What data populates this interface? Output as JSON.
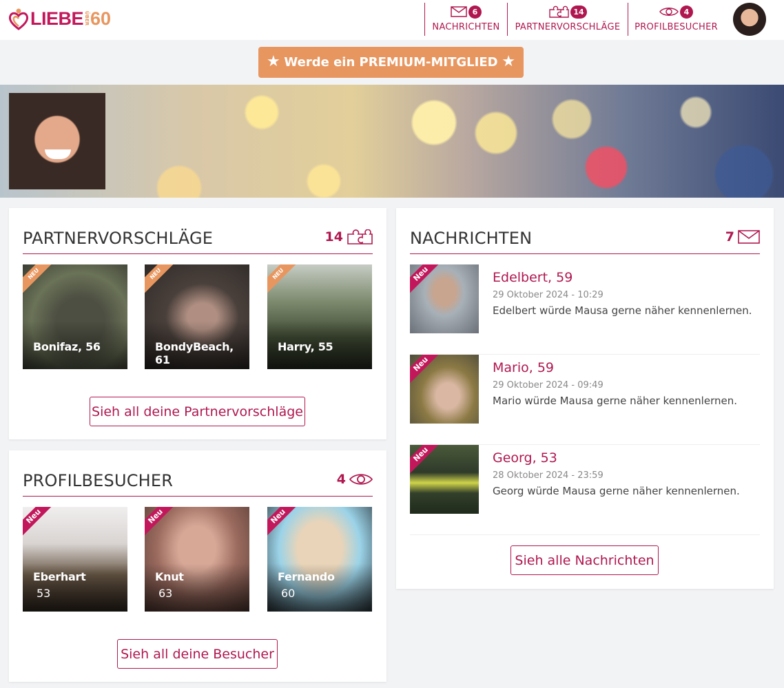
{
  "brand": {
    "name": "LIEBE",
    "small": "ÜBER",
    "age": "60"
  },
  "nav": {
    "messages": {
      "label": "NACHRICHTEN",
      "count": "6"
    },
    "matches": {
      "label": "PARTNERVORSCHLÄGE",
      "count": "14"
    },
    "visitors": {
      "label": "PROFILBESUCHER",
      "count": "4"
    }
  },
  "premium": {
    "label": "Werde ein PREMIUM-MITGLIED"
  },
  "matches": {
    "title": "PARTNERVORSCHLÄGE",
    "count": "14",
    "new_label": "NEU",
    "items": [
      {
        "name": "Bonifaz, 56"
      },
      {
        "name": "BondyBeach, 61"
      },
      {
        "name": "Harry, 55"
      }
    ],
    "button": "Sieh all deine Partnervorschläge"
  },
  "visitors": {
    "title": "PROFILBESUCHER",
    "count": "4",
    "new_label": "Neu",
    "items": [
      {
        "name": "Eberhart",
        "age": "53"
      },
      {
        "name": "Knut",
        "age": "63"
      },
      {
        "name": "Fernando",
        "age": "60"
      }
    ],
    "button": "Sieh all deine Besucher"
  },
  "messages": {
    "title": "NACHRICHTEN",
    "count": "7",
    "new_label": "Neu",
    "items": [
      {
        "name": "Edelbert, 59",
        "date": "29 Oktober 2024 - 10:29",
        "text": "Edelbert würde Mausa gerne näher kennenlernen."
      },
      {
        "name": "Mario, 59",
        "date": "29 Oktober 2024 - 09:49",
        "text": "Mario würde Mausa gerne näher kennenlernen."
      },
      {
        "name": "Georg, 53",
        "date": "28 Oktober 2024 - 23:59",
        "text": "Georg würde Mausa gerne näher kennenlernen."
      }
    ],
    "button": "Sieh alle Nachrichten"
  },
  "colors": {
    "accent": "#b0174f",
    "orange": "#e8965f"
  }
}
